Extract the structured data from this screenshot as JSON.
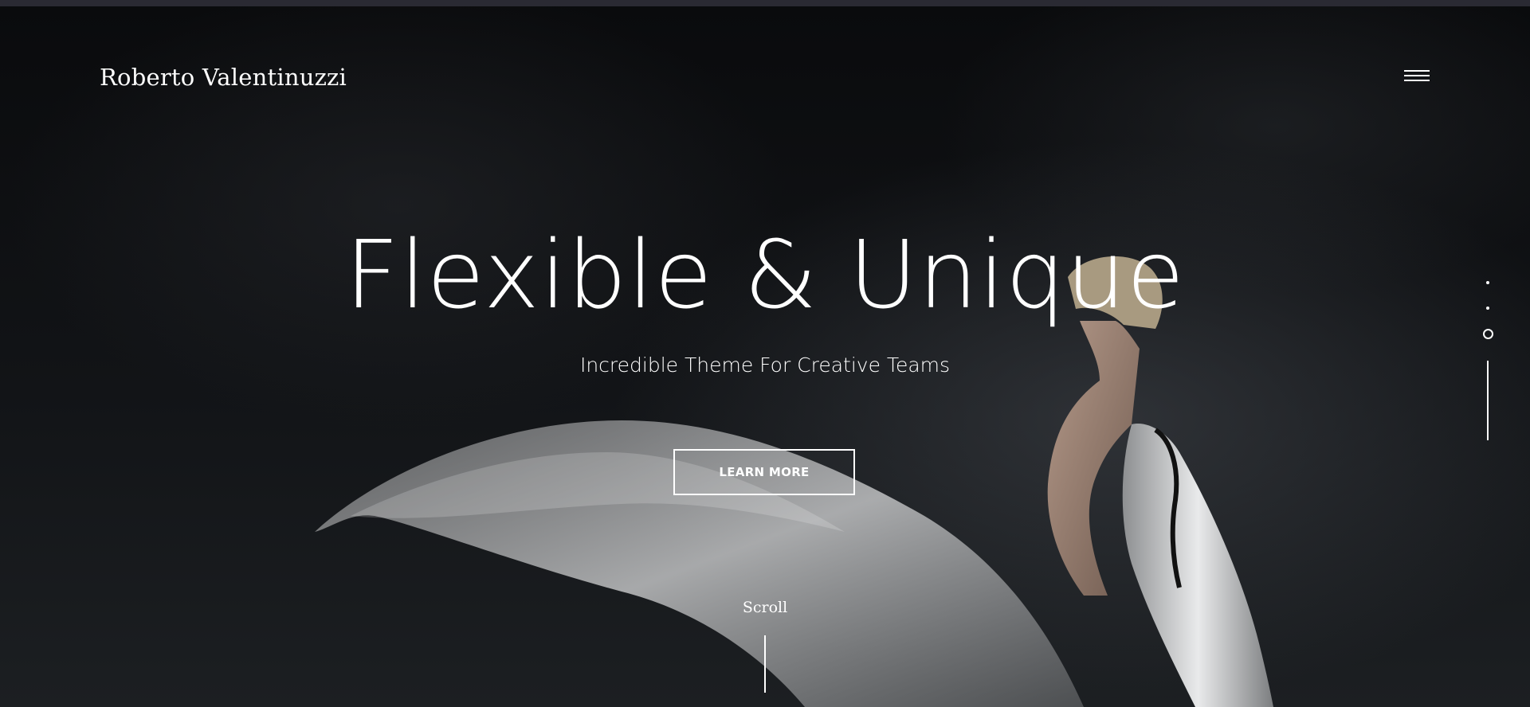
{
  "brand": {
    "name": "Roberto Valentinuzzi"
  },
  "header": {
    "menu_icon": "hamburger-menu-icon"
  },
  "hero": {
    "title": "Flexible & Unique",
    "subtitle": "Incredible Theme For Creative Teams",
    "cta_label": "LEARN MORE",
    "scroll_label": "Scroll"
  },
  "slide_nav": {
    "count": 3,
    "active_index": 3
  },
  "colors": {
    "text": "#ffffff",
    "background": "#0b0c0e"
  }
}
